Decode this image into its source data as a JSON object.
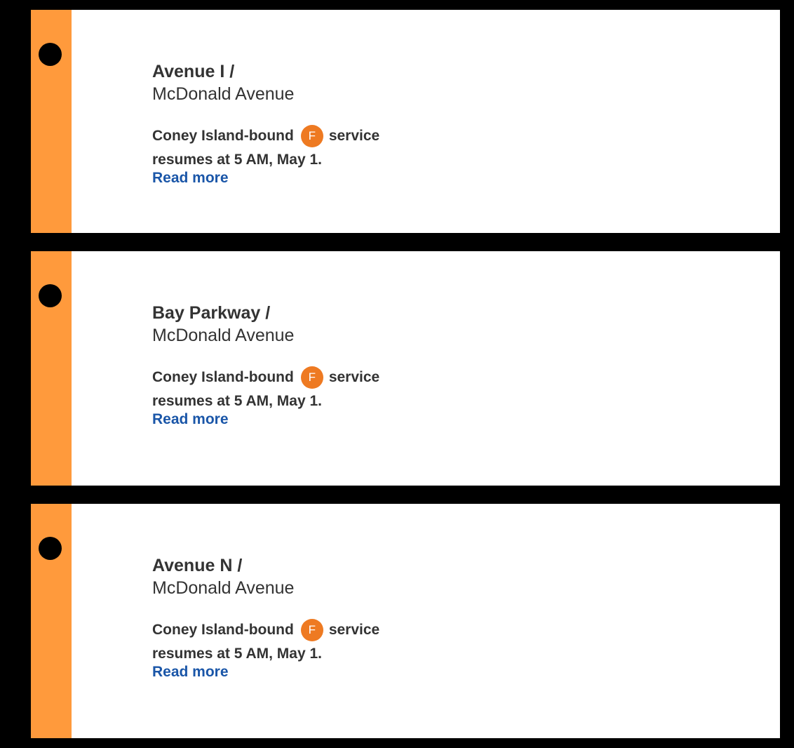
{
  "colors": {
    "line": "#ff9a3c",
    "route_bullet": "#ee7a22",
    "link": "#1a56a8",
    "text": "#333333"
  },
  "stations": [
    {
      "name": "Avenue I /",
      "cross_street": "McDonald Avenue",
      "alert_before": "Coney Island-bound",
      "route": "F",
      "alert_after": "service",
      "alert_line2": "resumes at 5 AM, May 1.",
      "link": "Read more"
    },
    {
      "name": "Bay Parkway /",
      "cross_street": "McDonald Avenue",
      "alert_before": "Coney Island-bound",
      "route": "F",
      "alert_after": "service",
      "alert_line2": "resumes at 5 AM, May 1.",
      "link": "Read more"
    },
    {
      "name": "Avenue N /",
      "cross_street": "McDonald Avenue",
      "alert_before": "Coney Island-bound",
      "route": "F",
      "alert_after": "service",
      "alert_line2": "resumes at 5 AM, May 1.",
      "link": "Read more"
    }
  ]
}
